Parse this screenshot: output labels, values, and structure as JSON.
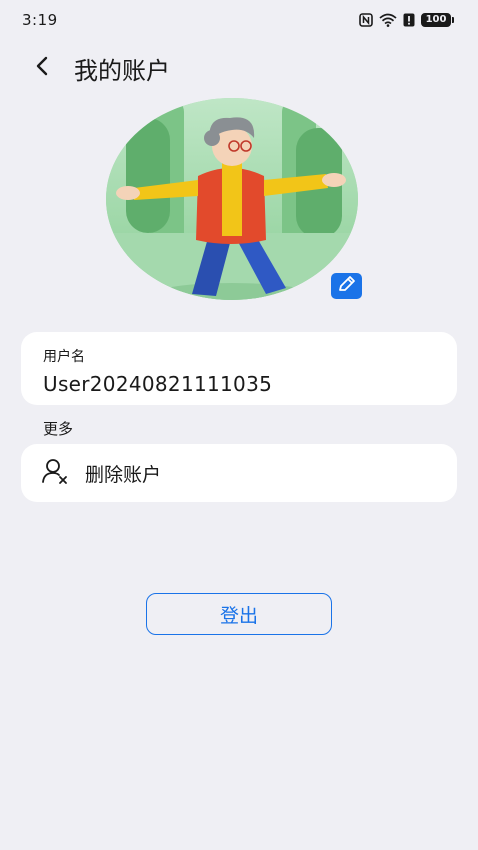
{
  "status_bar": {
    "time": "3:19",
    "battery": "100",
    "icons": [
      "nfc-icon",
      "wifi-icon",
      "alert-icon",
      "battery-icon"
    ]
  },
  "header": {
    "title": "我的账户",
    "back_icon": "chevron-left-icon"
  },
  "avatar": {
    "edit_icon": "pencil-icon"
  },
  "username": {
    "label": "用户名",
    "value": "User20240821111035"
  },
  "more_section": {
    "label": "更多",
    "items": [
      {
        "label": "删除账户",
        "icon": "user-remove-icon"
      }
    ]
  },
  "logout": {
    "label": "登出"
  },
  "colors": {
    "background": "#efeff4",
    "card": "#ffffff",
    "accent": "#1a73e8"
  }
}
